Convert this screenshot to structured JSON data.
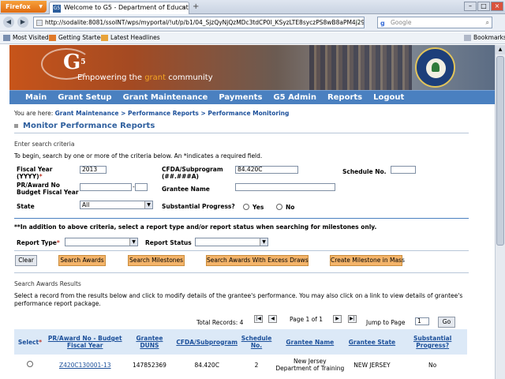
{
  "browser": {
    "app_button": "Firefox",
    "tab_title": "Welcome to G5 - Department of Educati...",
    "url": "http://sodalite:8081/ssoINT/wps/myportal/!ut/p/b1/04_SjzQyNjQzMDc3tdCP0I_KSyzLTE8syczPS8wB8aPM4j29Qo0",
    "search_placeholder": "Google",
    "bookmarks": [
      "Most Visited",
      "Getting Started",
      "Latest Headlines"
    ],
    "bookmarks_menu": "Bookmarks"
  },
  "banner": {
    "logo": "G",
    "logo_sup": "5",
    "tagline_pre": "Empowering the ",
    "tagline_accent": "grant",
    "tagline_post": " community"
  },
  "menu": [
    "Main",
    "Grant Setup",
    "Grant Maintenance",
    "Payments",
    "G5 Admin",
    "Reports",
    "Logout"
  ],
  "breadcrumb": {
    "prefix": "You are here:",
    "path": "Grant Maintenance > Performance Reports > Performance Monitoring"
  },
  "page_title": "Monitor Performance Reports",
  "criteria": {
    "section_label": "Enter search criteria",
    "instructions": "To begin, search by one or more of the criteria below.  An *indicates a required field.",
    "fiscal_year_label": "Fiscal Year",
    "fiscal_year_format": "(YYYY)",
    "fiscal_year_value": "2013",
    "cfda_label": "CFDA/Subprogram",
    "cfda_format": "(##.###A)",
    "cfda_value": "84.420C",
    "schedule_label": "Schedule No.",
    "pr_award_label_1": "PR/Award No",
    "pr_award_label_2": "Budget Fiscal Year",
    "pr_award_sep": "-",
    "grantee_name_label": "Grantee Name",
    "state_label": "State",
    "state_value": "All",
    "substantial_label": "Substantial Progress?",
    "yes_label": "Yes",
    "no_label": "No",
    "milestone_note": "**In addition to above criteria, select a report type and/or report status when searching for milestones only.",
    "report_type_label": "Report Type",
    "report_status_label": "Report Status"
  },
  "buttons": {
    "clear": "Clear",
    "search_awards": "Search Awards",
    "search_milestones": "Search Milestones",
    "search_excess": "Search Awards With Excess Draws",
    "create_milestone": "Create Milestone in Mass"
  },
  "results": {
    "section_label": "Search Awards Results",
    "instructions": "Select a record from the results below and click to modify details of the grantee's performance. You may also click on a link to view details of grantee's performance report package.",
    "total_records": "Total Records: 4",
    "page_info": "Page 1 of 1",
    "jump_label": "Jump to Page",
    "jump_value": "1",
    "go_label": "Go",
    "columns": {
      "select": "Select",
      "award": "PR/Award No - Budget Fiscal Year",
      "duns": "Grantee DUNS",
      "cfda": "CFDA/Subprogram",
      "schedule": "Schedule No.",
      "name": "Grantee Name",
      "state": "Grantee State",
      "progress": "Substantial Progress?"
    },
    "rows": [
      {
        "award": "Z420C130001-13",
        "duns": "147852369",
        "cfda": "84.420C",
        "schedule": "2",
        "name": "New Jersey Department of Training",
        "state": "NEW JERSEY",
        "progress": "No"
      }
    ]
  }
}
